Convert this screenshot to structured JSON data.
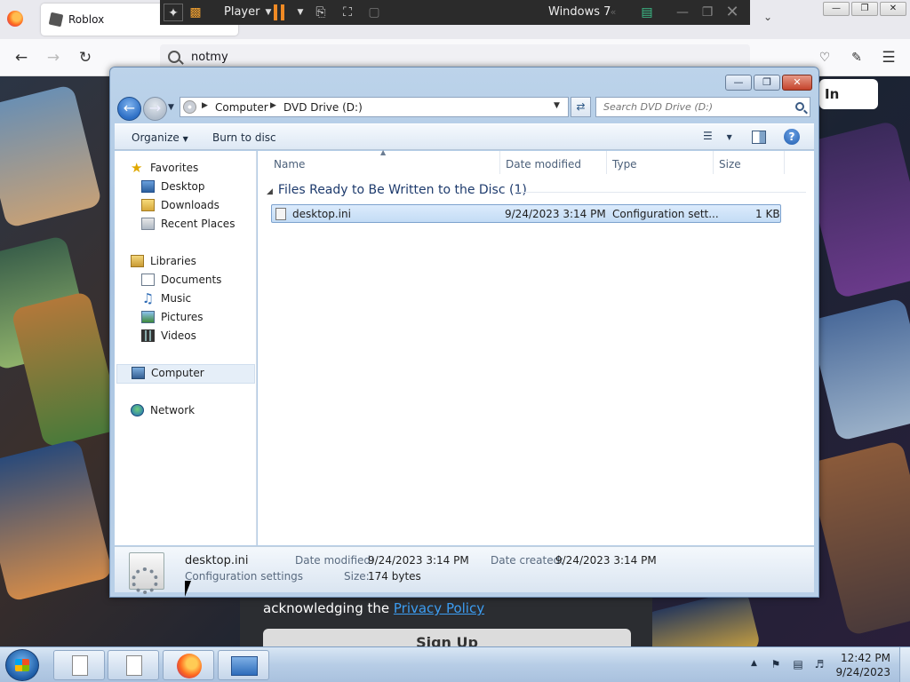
{
  "browser": {
    "tab_title": "Roblox",
    "url_text": "notmy",
    "window_controls": [
      "—",
      "❐",
      "✕"
    ]
  },
  "vmware": {
    "player_label": "Player",
    "vm_name": "Windows 7"
  },
  "webpage": {
    "login_label": "In",
    "legal_prefix": "acknowledging the ",
    "privacy_link": "Privacy Policy",
    "signup_label": "Sign Up"
  },
  "explorer": {
    "breadcrumbs": [
      "Computer",
      "DVD Drive (D:)"
    ],
    "search_placeholder": "Search DVD Drive (D:)",
    "commands": {
      "organize": "Organize",
      "burn": "Burn to disc"
    },
    "nav": {
      "favorites": "Favorites",
      "desktop": "Desktop",
      "downloads": "Downloads",
      "recent_places": "Recent Places",
      "libraries": "Libraries",
      "documents": "Documents",
      "music": "Music",
      "pictures": "Pictures",
      "videos": "Videos",
      "computer": "Computer",
      "network": "Network"
    },
    "columns": [
      "Name",
      "Date modified",
      "Type",
      "Size"
    ],
    "group_header": "Files Ready to Be Written to the Disc (1)",
    "files": [
      {
        "name": "desktop.ini",
        "date_modified": "9/24/2023 3:14 PM",
        "type": "Configuration sett...",
        "size": "1 KB"
      }
    ],
    "details": {
      "name": "desktop.ini",
      "type": "Configuration settings",
      "date_modified_label": "Date modified:",
      "date_modified": "9/24/2023 3:14 PM",
      "date_created_label": "Date created:",
      "date_created": "9/24/2023 3:14 PM",
      "size_label": "Size:",
      "size": "174 bytes"
    }
  },
  "taskbar": {
    "time": "12:42 PM",
    "date": "9/24/2023"
  },
  "colors": {
    "selection": "#cce4f9",
    "accent": "#2d6fc5",
    "link": "#3c9df2"
  }
}
